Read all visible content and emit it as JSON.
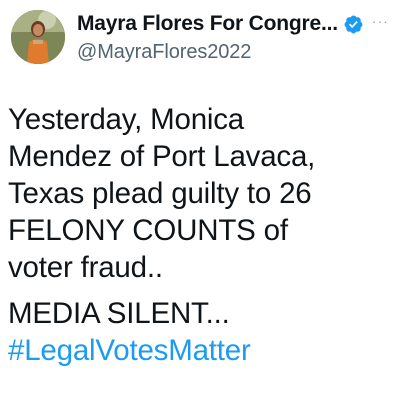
{
  "tweet": {
    "author": {
      "display_name": "Mayra Flores For Congre...",
      "handle": "@MayraFlores2022",
      "verified": true,
      "avatar_icon": "profile-photo",
      "more_icon": "more-options-icon"
    },
    "paragraphs": [
      "Yesterday, Monica\nMendez of Port Lavaca,\nTexas plead guilty to 26\nFELONY COUNTS of\nvoter fraud..",
      "MEDIA SILENT..."
    ],
    "hashtag": "#LegalVotesMatter",
    "colors": {
      "text": "#0f1419",
      "secondary": "#536471",
      "link": "#1d9bf0",
      "verified_badge": "#1d9bf0"
    }
  }
}
